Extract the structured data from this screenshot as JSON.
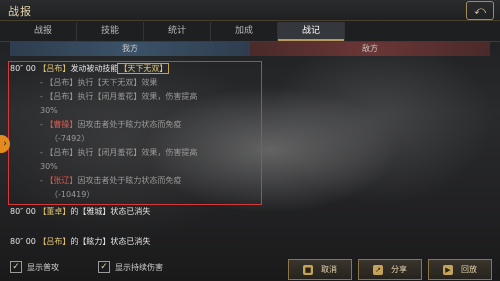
{
  "header": {
    "title": "战报",
    "back_icon": "return-icon"
  },
  "tabs": [
    {
      "label": "战报",
      "active": false
    },
    {
      "label": "技能",
      "active": false
    },
    {
      "label": "统计",
      "active": false
    },
    {
      "label": "加成",
      "active": false
    },
    {
      "label": "战记",
      "active": true
    }
  ],
  "sides": {
    "ally": "我方",
    "enemy": "敌方"
  },
  "log": {
    "l1": {
      "time": "80″ 00",
      "actor": "【吕布】",
      "text": "发动被动技能",
      "skill": "【天下无双】"
    },
    "l2": {
      "prefix": "- 【吕布】",
      "text": "执行【天下无双】效果"
    },
    "l3": {
      "prefix": "- 【吕布】",
      "text": "执行【闭月羞花】效果，伤害提高"
    },
    "l4": "30%",
    "l5": {
      "prefix": "- ",
      "actor": "【曹操】",
      "text": "因攻击者处于眩力状态而免疫"
    },
    "l6": "（-7492）",
    "l7": {
      "prefix": "- 【吕布】",
      "text": "执行【闭月羞花】效果，伤害提高"
    },
    "l8": "30%",
    "l9": {
      "prefix": "- ",
      "actor": "【张辽】",
      "text": "因攻击者处于眩力状态而免疫"
    },
    "l10": "（-10419）",
    "l11": {
      "time": "80″ 00",
      "actor": "【董卓】",
      "text": "的【雅城】状态已消失"
    },
    "l12": {
      "time": "80″ 00",
      "actor": "【吕布】",
      "text": "的【眩力】状态已消失"
    }
  },
  "footer": {
    "check1": {
      "label": "显示普攻",
      "checked": true
    },
    "check2": {
      "label": "显示持续伤害",
      "checked": true
    },
    "cancel": "取消",
    "share": "分享",
    "replay": "回放"
  },
  "colors": {
    "highlight": "#d43a3a",
    "enemy_name": "#e05a4e",
    "ally_name": "#e4c674",
    "accent": "#c8a24a"
  }
}
